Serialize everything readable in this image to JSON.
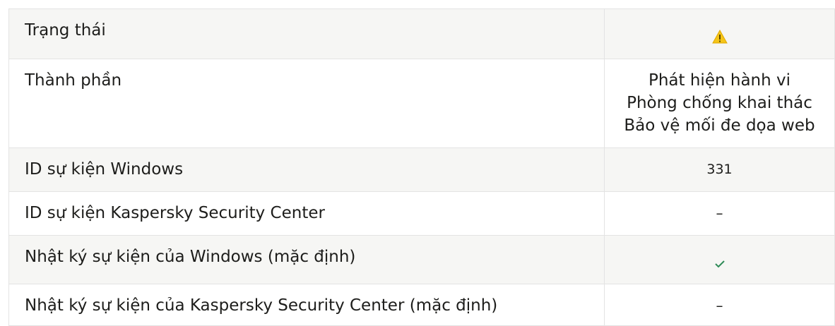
{
  "table": {
    "rows": [
      {
        "label": "Trạng thái",
        "value_icon": "warning-icon",
        "status_color": "#f5c518"
      },
      {
        "label": "Thành phần",
        "components": [
          "Phát hiện hành vi",
          "Phòng chống khai thác",
          "Bảo vệ mối đe dọa web"
        ]
      },
      {
        "label": "ID sự kiện Windows",
        "value": "331"
      },
      {
        "label": "ID sự kiện Kaspersky Security Center",
        "value": "–"
      },
      {
        "label": "Nhật ký sự kiện của Windows (mặc định)",
        "value_icon": "checkmark-icon",
        "check_color": "#2e8b57"
      },
      {
        "label": "Nhật ký sự kiện của Kaspersky Security Center (mặc định)",
        "value": "–"
      }
    ]
  }
}
